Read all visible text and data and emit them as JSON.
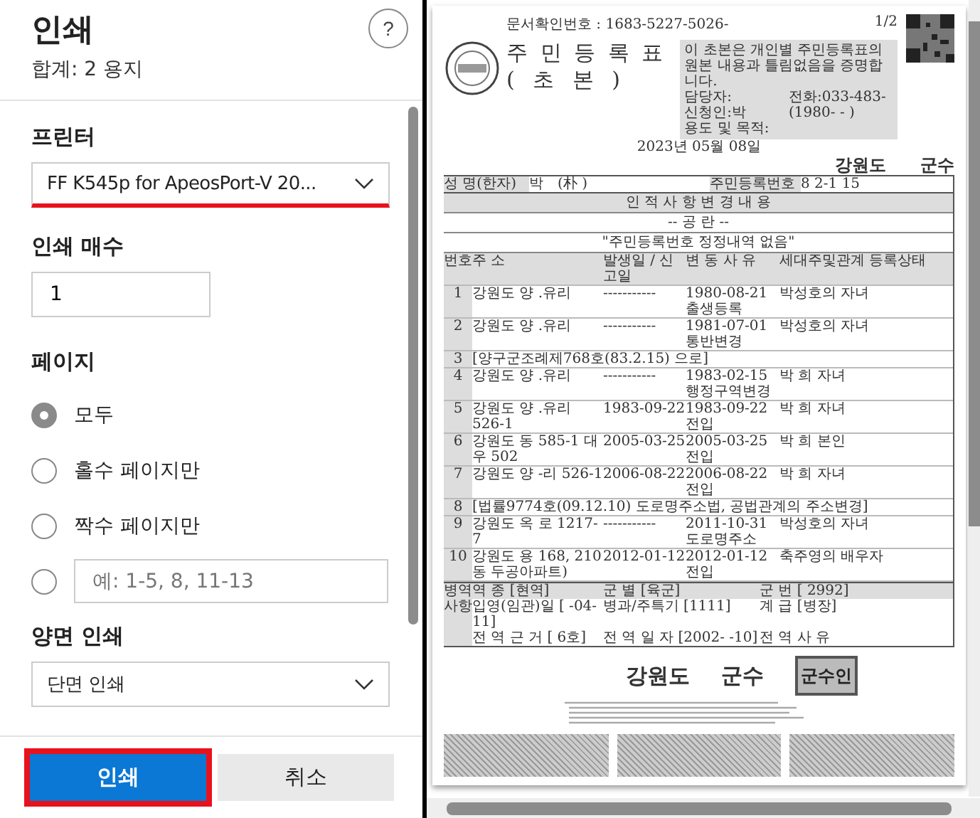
{
  "panel": {
    "title": "인쇄",
    "summary": "합계: 2 용지",
    "help": "?"
  },
  "printer": {
    "label": "프린터",
    "value": "FF K545p for ApeosPort-V 20...",
    "highlighted": true
  },
  "copies": {
    "label": "인쇄 매수",
    "value": "1"
  },
  "pages": {
    "label": "페이지",
    "options": [
      {
        "kind": "radio",
        "label": "모두",
        "selected": true
      },
      {
        "kind": "radio",
        "label": "홀수 페이지만",
        "selected": false
      },
      {
        "kind": "radio",
        "label": "짝수 페이지만",
        "selected": false
      },
      {
        "kind": "range",
        "placeholder": "예: 1-5, 8, 11-13",
        "selected": false
      }
    ]
  },
  "duplex": {
    "label": "양면 인쇄",
    "value": "단면 인쇄"
  },
  "buttons": [
    {
      "kind": "primary",
      "label": "인쇄",
      "highlighted": true
    },
    {
      "kind": "secondary",
      "label": "취소",
      "highlighted": false
    }
  ],
  "preview": {
    "doc_number": "문서확인번호 : 1683-5227-5026-",
    "page_indicator": "1/2",
    "title": "주 민 등 록 표",
    "subtitle": "( 초 본 )",
    "certification": [
      "이 초본은 개인별 주민등록표의 원본 내용과 틀림없음을 증명합니다.",
      "담당자:",
      "전화:033-483-",
      "신청인:박",
      "(1980-  -  )",
      "용도 및 목적:"
    ],
    "date": "2023년 05월 08일",
    "region": "강원도",
    "issuer": "군수",
    "name_label": "성 명(한자)",
    "name_value": "박",
    "name_hanja": "(朴 )",
    "rrn_label": "주민등록번호",
    "rrn_value": "8  2-1  15",
    "section_title": "인 적 사 항 변 경 내 용",
    "blank_note": "-- 공 란 --",
    "correction_note": "\"주민등록번호 정정내역 없음\"",
    "columns": [
      "번호",
      "주 소",
      "발생일 / 신고일",
      "변 동 사 유",
      "세대주및관계 등록상태"
    ],
    "rows": [
      {
        "kind": "entry",
        "no": "1",
        "address": "강원도 양  .유리",
        "occurred": "-----------",
        "reported": "1980-08-21",
        "reason": "출생등록",
        "relation": "박성호의 자녀"
      },
      {
        "kind": "entry",
        "no": "2",
        "address": "강원도 양  .유리",
        "occurred": "-----------",
        "reported": "1981-07-01",
        "reason": "통반변경",
        "relation": "박성호의 자녀"
      },
      {
        "kind": "note",
        "no": "3",
        "text": "[양구군조례제768호(83.2.15)  으로]"
      },
      {
        "kind": "entry",
        "no": "4",
        "address": "강원도 양  .유리",
        "occurred": "-----------",
        "reported": "1983-02-15",
        "reason": "행정구역변경",
        "relation": "박 희 자녀"
      },
      {
        "kind": "entry",
        "no": "5",
        "address": "강원도 양  .유리 526-1",
        "occurred": "1983-09-22",
        "reported": "1983-09-22",
        "reason": "전입",
        "relation": "박 희 자녀"
      },
      {
        "kind": "entry",
        "no": "6",
        "address": "강원도  동 585-1 대우 502",
        "occurred": "2005-03-25",
        "reported": "2005-03-25",
        "reason": "전입",
        "relation": "박 희 본인"
      },
      {
        "kind": "entry",
        "no": "7",
        "address": "강원도 양  -리 526-1",
        "occurred": "2006-08-22",
        "reported": "2006-08-22",
        "reason": "전입",
        "relation": "박 희 자녀"
      },
      {
        "kind": "note",
        "no": "8",
        "text": "[법률9774호(09.12.10) 도로명주소법, 공법관계의 주소변경]"
      },
      {
        "kind": "entry",
        "no": "9",
        "address": "강원도 옥  로 1217-7",
        "occurred": "-----------",
        "reported": "2011-10-31",
        "reason": "도로명주소",
        "relation": "박성호의 자녀"
      },
      {
        "kind": "entry",
        "no": "10",
        "address": "강원도 용  168, 210동 두공아파트)",
        "occurred": "2012-01-12",
        "reported": "2012-01-12",
        "reason": "전입",
        "relation": "축주영의 배우자"
      }
    ],
    "military_label": "병역 사항",
    "military": [
      [
        "역 종 [현역]",
        "군 별 [육군]",
        "군 번 [  2992]"
      ],
      [
        "입영(임관)일 [ -04-11]",
        "병과/주특기 [1111]",
        "계 급 [병장]"
      ],
      [
        "전 역 근 거 [  6호]",
        "전 역 일 자 [2002-  -10]",
        "전 역 사 유"
      ]
    ],
    "sign_region": "강원도",
    "sign_issuer": "군수",
    "seal": "군수인"
  }
}
